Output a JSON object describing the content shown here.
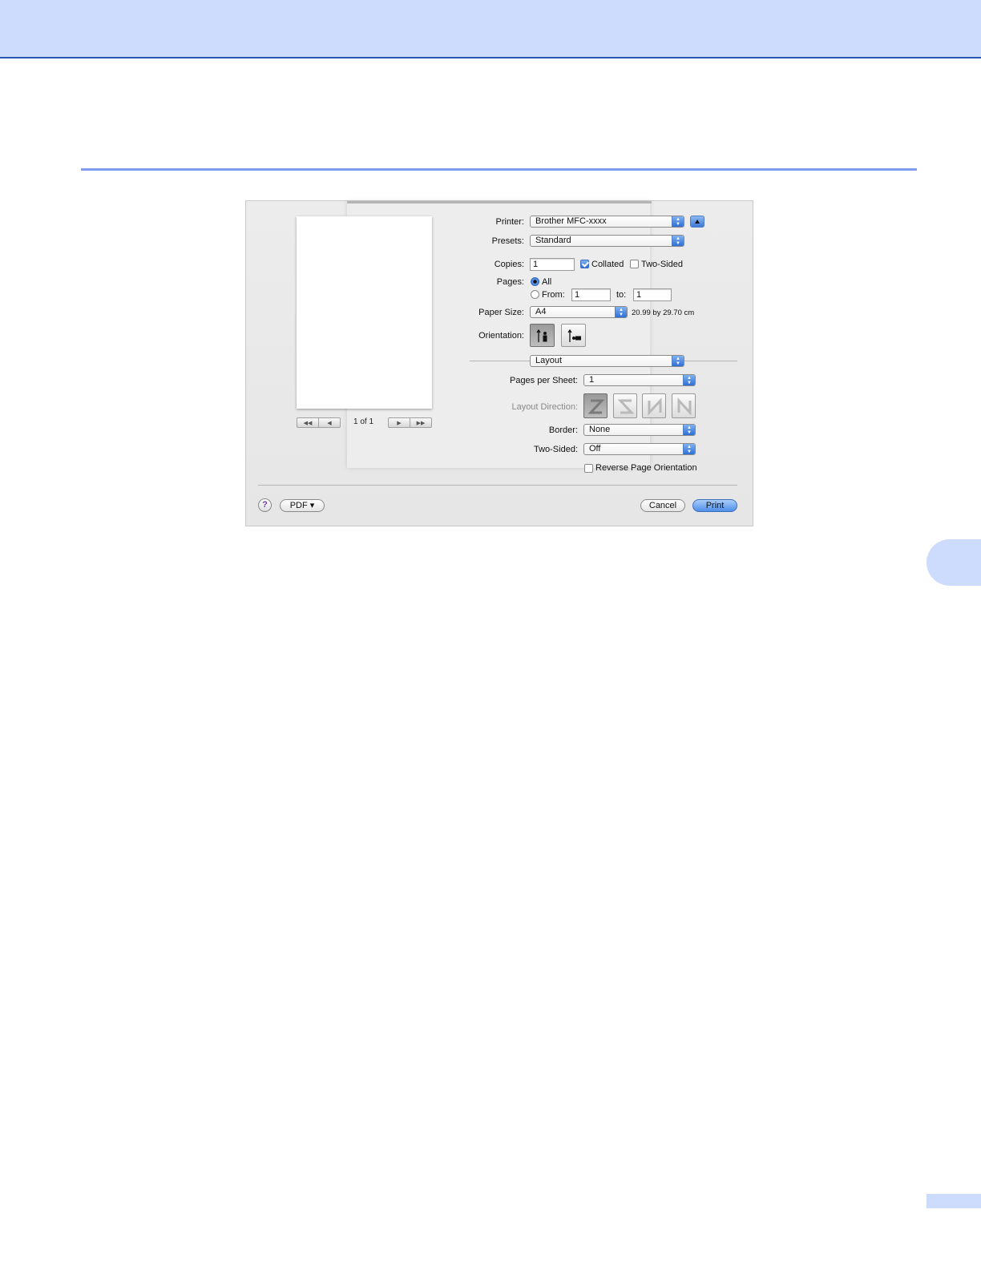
{
  "dialog": {
    "printer": {
      "label": "Printer:",
      "value": "Brother MFC-xxxx"
    },
    "presets": {
      "label": "Presets:",
      "value": "Standard"
    },
    "copies": {
      "label": "Copies:",
      "value": "1",
      "collated_label": "Collated",
      "collated_checked": true,
      "two_sided_label": "Two-Sided",
      "two_sided_checked": false
    },
    "pages": {
      "label": "Pages:",
      "all_label": "All",
      "from_label": "From:",
      "from_value": "1",
      "to_label": "to:",
      "to_value": "1",
      "selected": "All"
    },
    "paper_size": {
      "label": "Paper Size:",
      "value": "A4",
      "dimensions": "20.99 by 29.70 cm"
    },
    "orientation": {
      "label": "Orientation:",
      "selected": "portrait"
    },
    "panel_select": {
      "value": "Layout"
    },
    "layout": {
      "pages_per_sheet": {
        "label": "Pages per Sheet:",
        "value": "1"
      },
      "layout_direction": {
        "label": "Layout Direction:",
        "selected": "Z"
      },
      "border": {
        "label": "Border:",
        "value": "None"
      },
      "two_sided": {
        "label": "Two-Sided:",
        "value": "Off"
      },
      "reverse_orientation": {
        "label": "Reverse Page Orientation",
        "checked": false
      }
    },
    "preview": {
      "page_indicator": "1 of 1"
    },
    "buttons": {
      "help": "?",
      "pdf": "PDF ▾",
      "cancel": "Cancel",
      "print": "Print"
    }
  },
  "colors": {
    "header_band": "#cddcfd",
    "header_line": "#2b55b5",
    "rule": "#7f9cf2",
    "accent": "#2f6fd6"
  }
}
